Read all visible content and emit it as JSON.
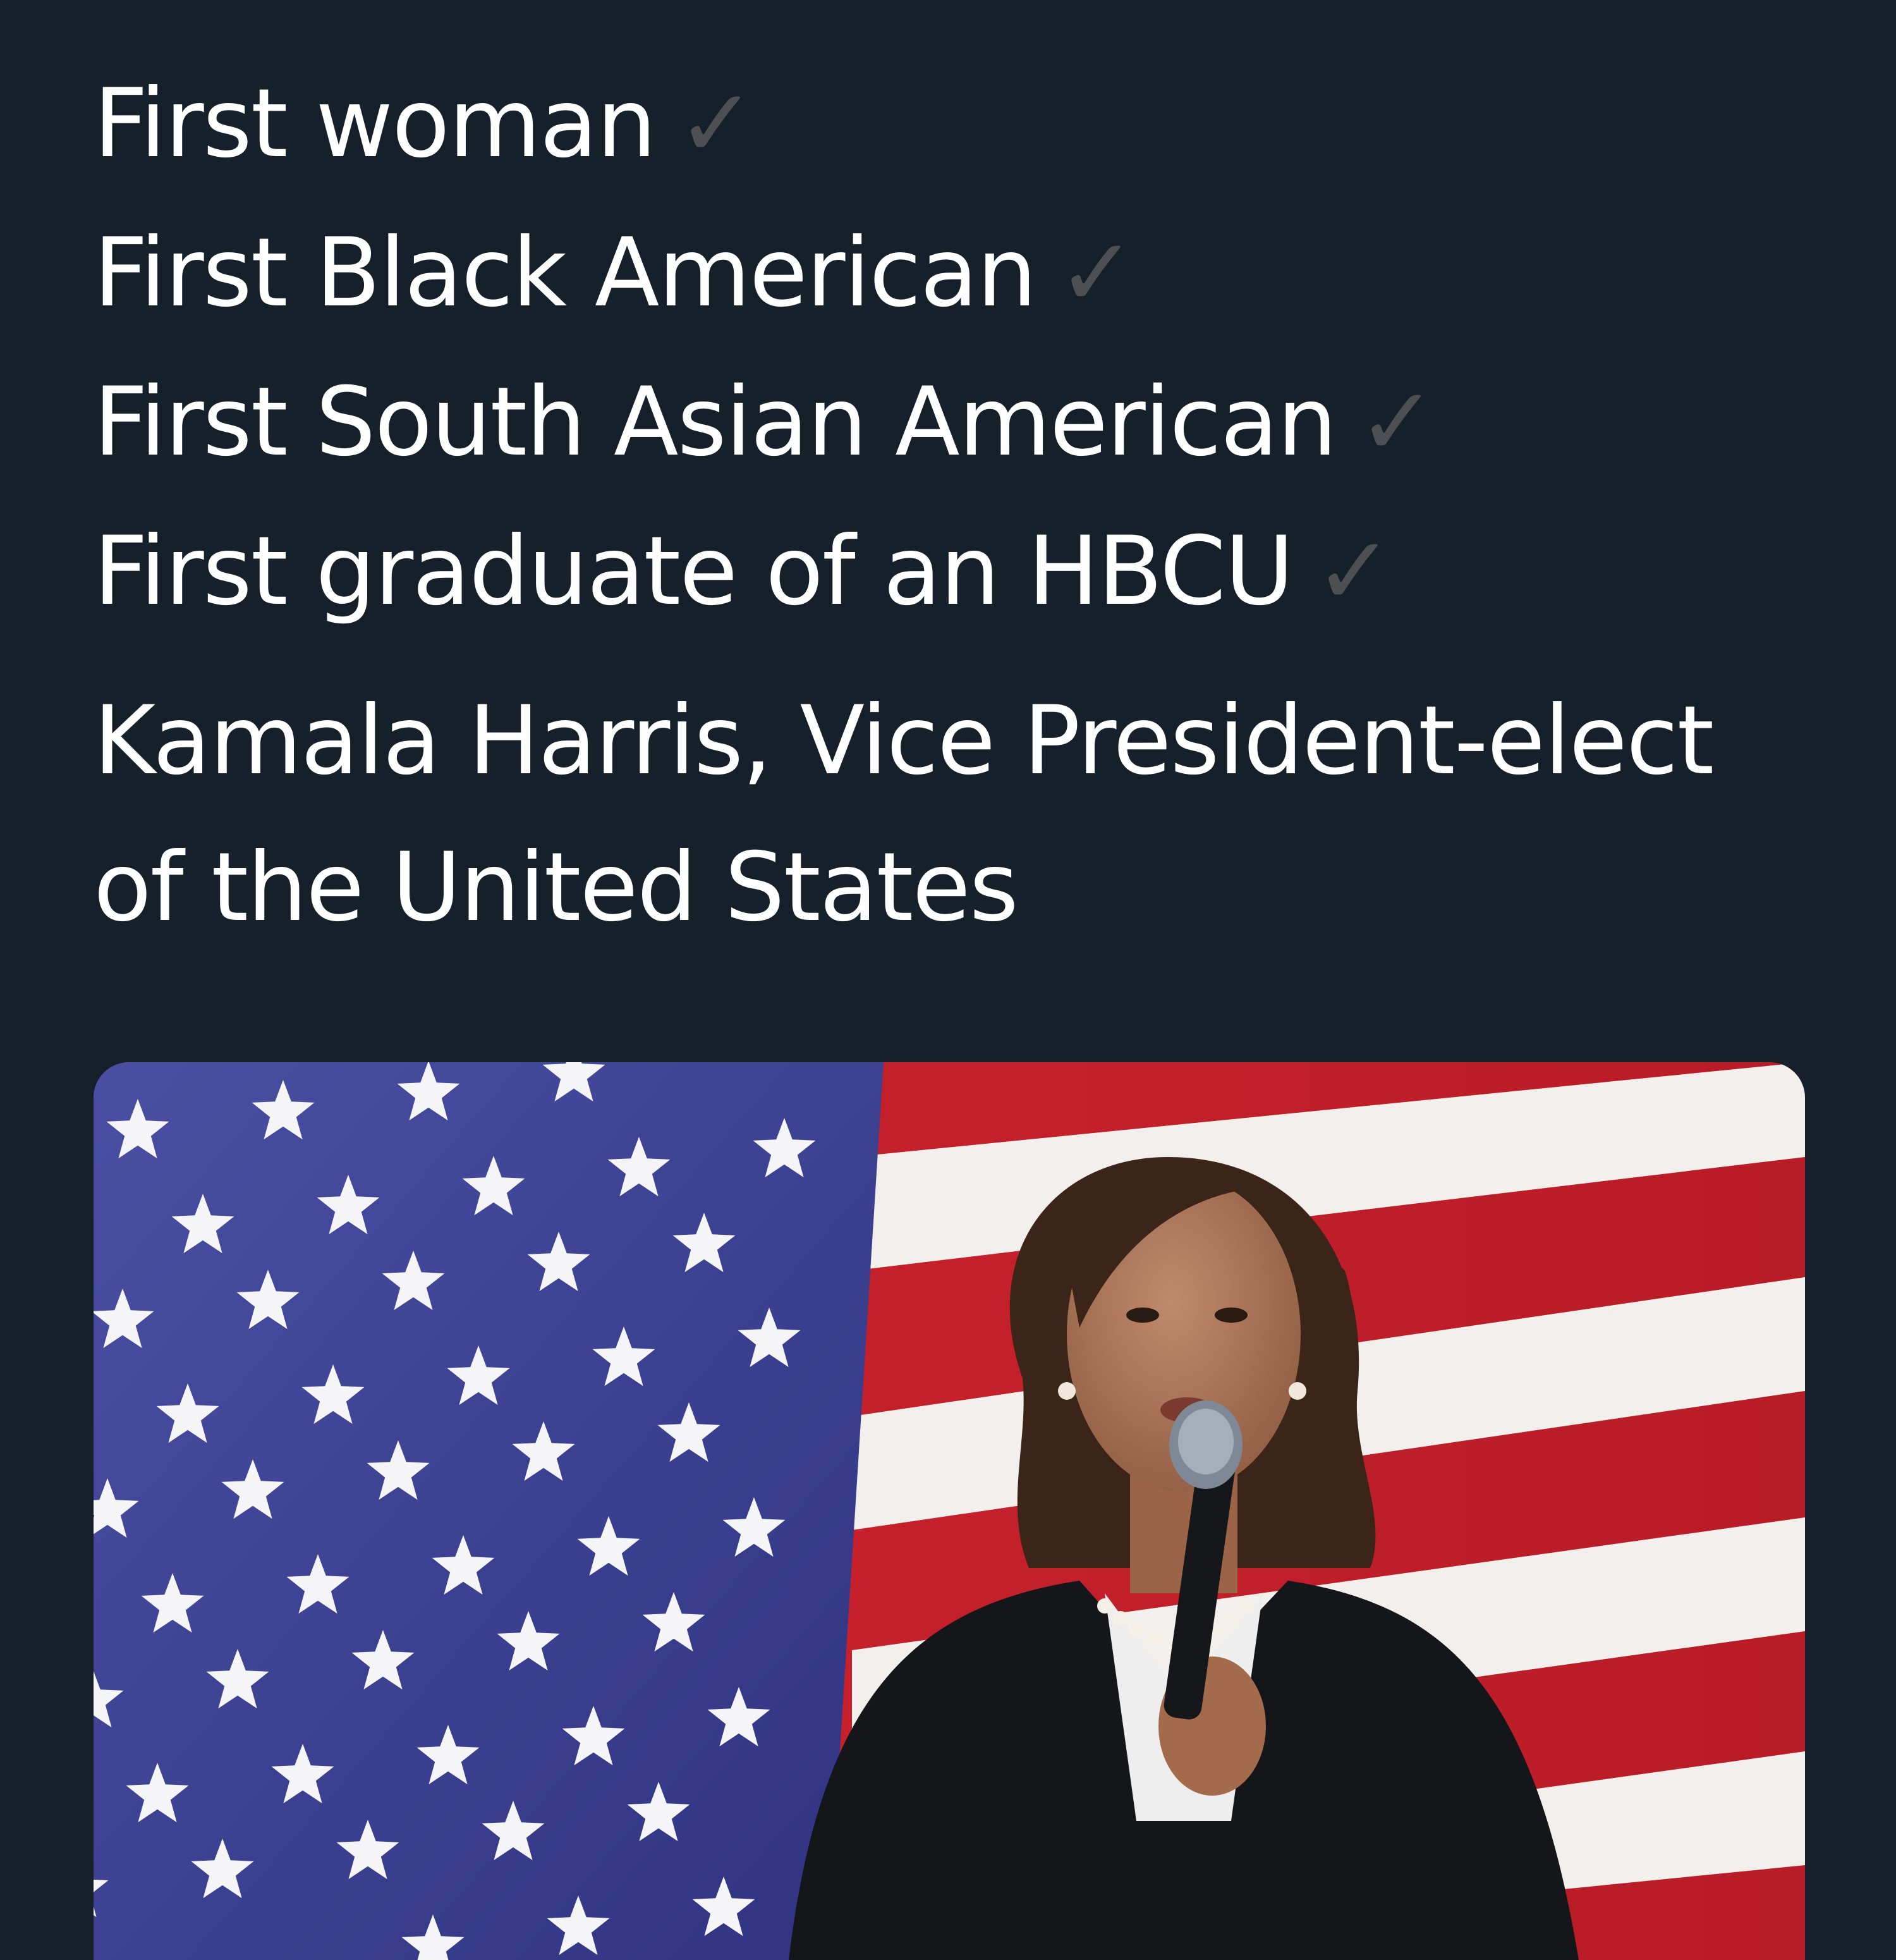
{
  "tweet": {
    "lines": [
      {
        "text": "First woman",
        "check": "✓"
      },
      {
        "text": "First Black American",
        "check": "✓"
      },
      {
        "text": "First South Asian American",
        "check": "✓"
      },
      {
        "text": "First graduate of an HBCU",
        "check": "✓"
      }
    ],
    "caption_line1": "Kamala Harris, Vice President-elect",
    "caption_line2": "of the United States"
  },
  "colors": {
    "background": "#15202b",
    "text": "#ffffff",
    "check": "#4d4f52",
    "flag_blue": "#3a3f8f",
    "flag_red": "#c41e2a"
  },
  "icons": {
    "check": "check-mark-icon"
  }
}
